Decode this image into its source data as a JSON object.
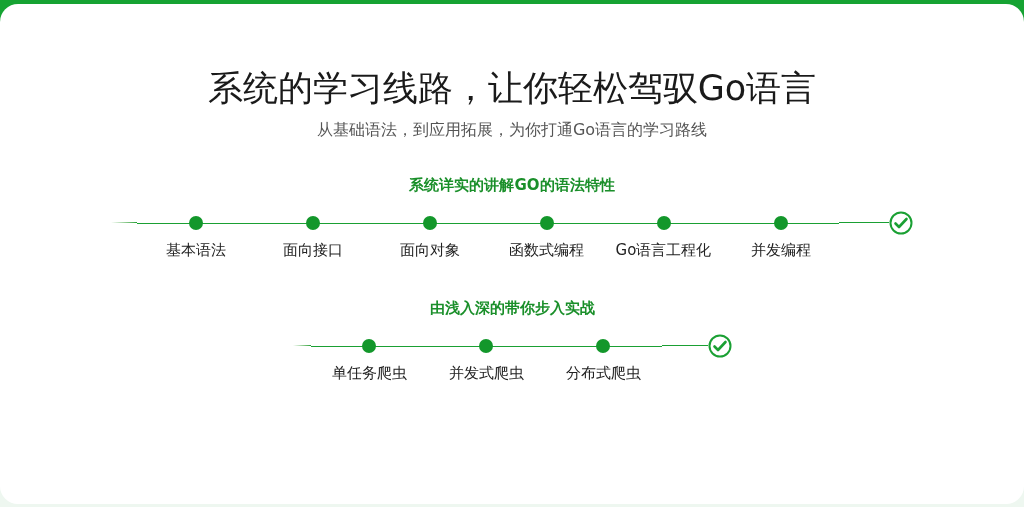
{
  "title": "系统的学习线路，让你轻松驾驭Go语言",
  "subtitle": "从基础语法，到应用拓展，为你打通Go语言的学习路线",
  "tracks": [
    {
      "title": "系统详实的讲解GO的语法特性",
      "steps": [
        {
          "label": "基本语法"
        },
        {
          "label": "面向接口"
        },
        {
          "label": "面向对象"
        },
        {
          "label": "函数式编程"
        },
        {
          "label": "Go语言工程化"
        },
        {
          "label": "并发编程"
        }
      ]
    },
    {
      "title": "由浅入深的带你步入实战",
      "steps": [
        {
          "label": "单任务爬虫"
        },
        {
          "label": "并发式爬虫"
        },
        {
          "label": "分布式爬虫"
        }
      ]
    }
  ]
}
